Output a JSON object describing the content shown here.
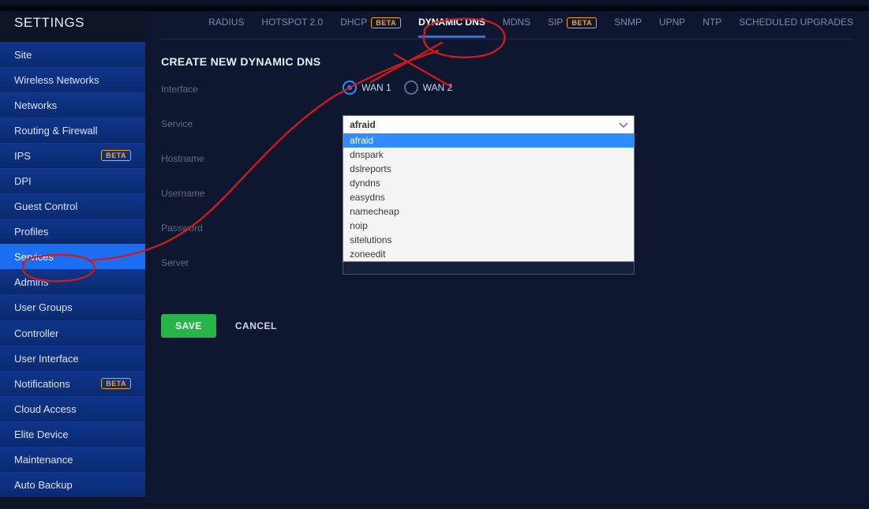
{
  "heading": "SETTINGS",
  "badge_text": "BETA",
  "sidebar": {
    "items": [
      {
        "label": "Site",
        "badge": false
      },
      {
        "label": "Wireless Networks",
        "badge": false
      },
      {
        "label": "Networks",
        "badge": false
      },
      {
        "label": "Routing & Firewall",
        "badge": false
      },
      {
        "label": "IPS",
        "badge": true
      },
      {
        "label": "DPI",
        "badge": false
      },
      {
        "label": "Guest Control",
        "badge": false
      },
      {
        "label": "Profiles",
        "badge": false
      },
      {
        "label": "Services",
        "badge": false,
        "active": true
      },
      {
        "label": "Admins",
        "badge": false
      },
      {
        "label": "User Groups",
        "badge": false
      },
      {
        "_sep": true,
        "label": ""
      },
      {
        "label": "Controller",
        "badge": false
      },
      {
        "label": "User Interface",
        "badge": false
      },
      {
        "label": "Notifications",
        "badge": true
      },
      {
        "label": "Cloud Access",
        "badge": false
      },
      {
        "label": "Elite Device",
        "badge": false
      },
      {
        "label": "Maintenance",
        "badge": false
      },
      {
        "label": "Auto Backup",
        "badge": false
      }
    ]
  },
  "tabs": [
    {
      "label": "RADIUS"
    },
    {
      "label": "HOTSPOT 2.0"
    },
    {
      "label": "DHCP",
      "badge": true
    },
    {
      "label": "DYNAMIC DNS",
      "active": true
    },
    {
      "label": "MDNS"
    },
    {
      "label": "SIP",
      "badge": true
    },
    {
      "label": "SNMP"
    },
    {
      "label": "UPNP"
    },
    {
      "label": "NTP"
    },
    {
      "label": "SCHEDULED UPGRADES"
    }
  ],
  "section_title": "CREATE NEW DYNAMIC DNS",
  "fields": {
    "interface_label": "Interface",
    "wan1": "WAN 1",
    "wan2": "WAN 2",
    "service_label": "Service",
    "hostname_label": "Hostname",
    "username_label": "Username",
    "password_label": "Password",
    "server_label": "Server"
  },
  "service": {
    "selected": "afraid",
    "options": [
      "afraid",
      "dnspark",
      "dslreports",
      "dyndns",
      "easydns",
      "namecheap",
      "noip",
      "sitelutions",
      "zoneedit"
    ]
  },
  "buttons": {
    "save": "SAVE",
    "cancel": "CANCEL"
  }
}
